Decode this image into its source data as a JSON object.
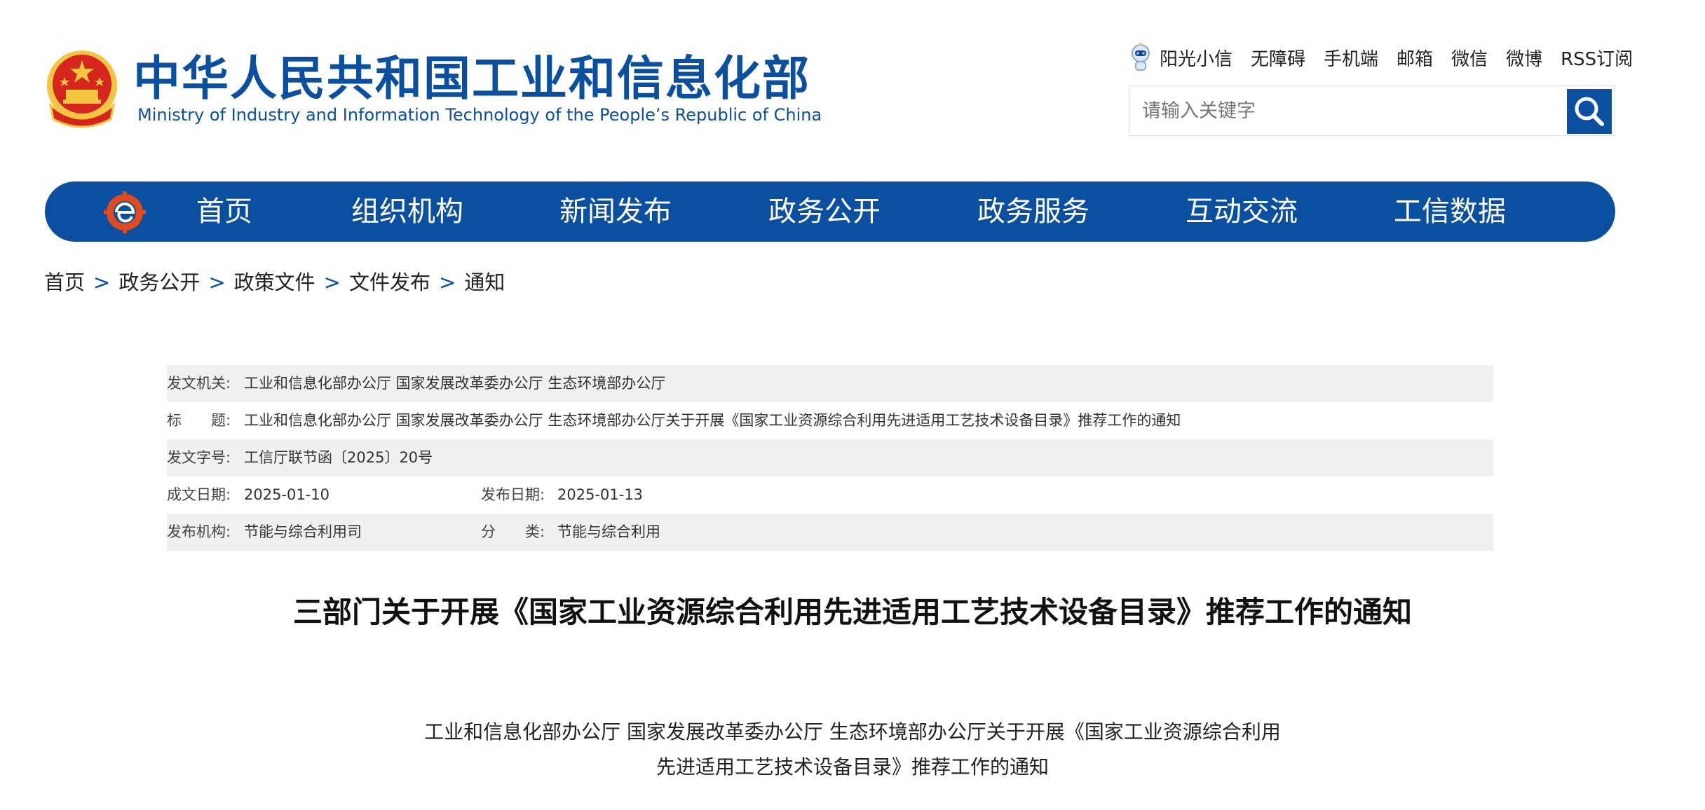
{
  "header": {
    "title_cn": "中华人民共和国工业和信息化部",
    "title_en": "Ministry of Industry and Information Technology of the People’s Republic of China",
    "toplinks": [
      "阳光小信",
      "无障碍",
      "手机端",
      "邮箱",
      "微信",
      "微博",
      "RSS订阅"
    ],
    "search_placeholder": "请输入关键字"
  },
  "nav": {
    "items": [
      "首页",
      "组织机构",
      "新闻发布",
      "政务公开",
      "政务服务",
      "互动交流",
      "工信数据"
    ]
  },
  "breadcrumb": [
    "首页",
    "政务公开",
    "政策文件",
    "文件发布",
    "通知"
  ],
  "breadcrumb_sep": ">",
  "meta": {
    "issuer_label": "发文机关:",
    "issuer": "工业和信息化部办公厅 国家发展改革委办公厅 生态环境部办公厅",
    "title_label": "标　　题:",
    "title": "工业和信息化部办公厅 国家发展改革委办公厅 生态环境部办公厅关于开展《国家工业资源综合利用先进适用工艺技术设备目录》推荐工作的通知",
    "doc_no_label": "发文字号:",
    "doc_no": "工信厅联节函〔2025〕20号",
    "created_label": "成文日期:",
    "created": "2025-01-10",
    "published_label": "发布日期:",
    "published": "2025-01-13",
    "org_label": "发布机构:",
    "org": "节能与综合利用司",
    "category_label": "分　　类:",
    "category": "节能与综合利用"
  },
  "article": {
    "title": "三部门关于开展《国家工业资源综合利用先进适用工艺技术设备目录》推荐工作的通知",
    "subtitle_line1": "工业和信息化部办公厅  国家发展改革委办公厅  生态环境部办公厅关于开展《国家工业资源综合利用",
    "subtitle_line2": "先进适用工艺技术设备目录》推荐工作的通知"
  },
  "colors": {
    "brand_blue": "#0b4fa1",
    "row_shade": "#f0f0f0",
    "emblem_red": "#d6251d",
    "emblem_gold": "#f4c542"
  },
  "icons": [
    "national-emblem-icon",
    "robot-mascot-icon",
    "search-icon",
    "nav-logo-icon"
  ]
}
